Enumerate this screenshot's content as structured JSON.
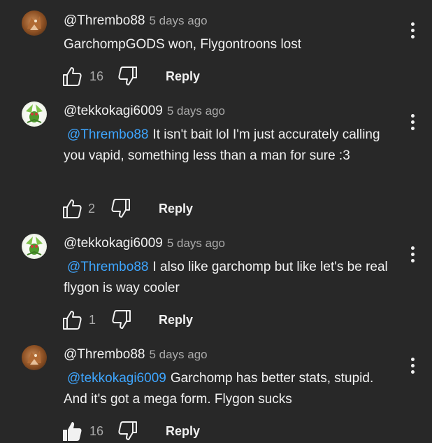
{
  "comments": [
    {
      "author": "@Thrembo88",
      "time": "5 days ago",
      "mention": "",
      "text": "GarchompGODS won, Flygontroons lost",
      "likes": "16",
      "reply_label": "Reply",
      "liked": false,
      "avatar": "garchomp-avatar"
    },
    {
      "author": "@tekkokagi6009",
      "time": "5 days ago",
      "mention": "@Thrembo88",
      "text": "It isn't bait lol I'm just accurately calling you vapid, something less than a man for sure :3",
      "likes": "2",
      "reply_label": "Reply",
      "liked": false,
      "avatar": "flygon-avatar"
    },
    {
      "author": "@tekkokagi6009",
      "time": "5 days ago",
      "mention": "@Thrembo88",
      "text": "I also like garchomp but like let's be real flygon is way cooler",
      "likes": "1",
      "reply_label": "Reply",
      "liked": false,
      "avatar": "flygon-avatar"
    },
    {
      "author": "@Thrembo88",
      "time": "5 days ago",
      "mention": "@tekkokagi6009",
      "text": "Garchomp has better stats, stupid. And it's got a mega form. Flygon sucks",
      "likes": "16",
      "reply_label": "Reply",
      "liked": true,
      "avatar": "garchomp-avatar"
    }
  ],
  "colors": {
    "background": "#282828",
    "mention": "#3ea6ff",
    "meta": "#aaaaaa",
    "text": "#f1f1f1"
  }
}
